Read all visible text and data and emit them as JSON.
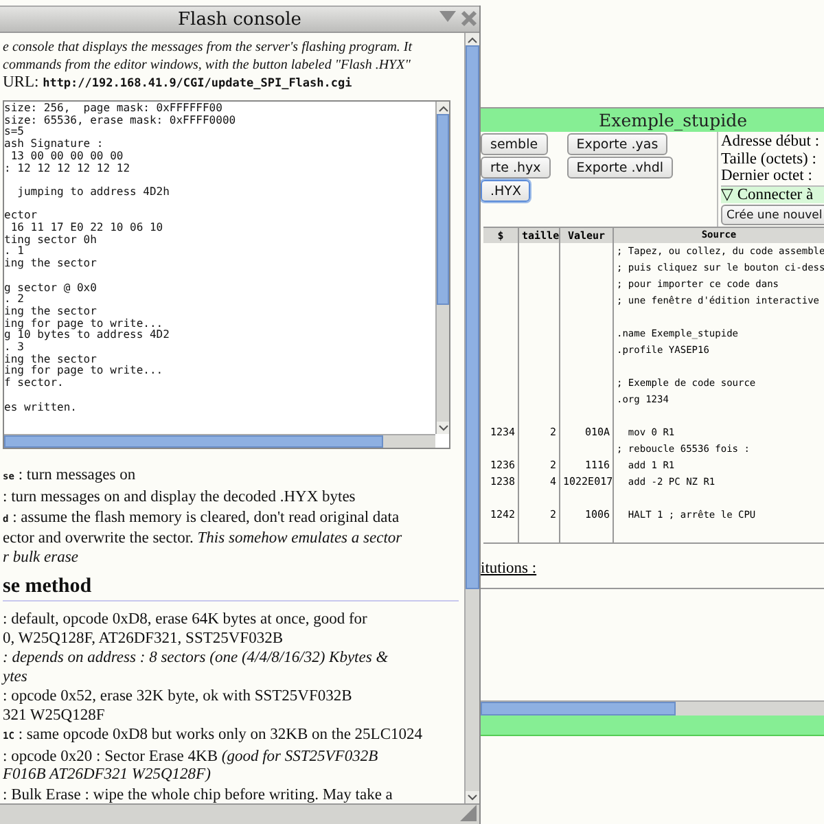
{
  "flash_console": {
    "title": "Flash console",
    "intro_lines": [
      {
        "text": "e console that displays the messages from the server's flashing program. It"
      },
      {
        "text": "commands from the editor windows, with the button labeled \"Flash .HYX\""
      }
    ],
    "url_line": "URL: **http://192.168.41.9/CGI/update_SPI_Flash.cgi**",
    "console_lines": [
      {
        "text": "size: 256,  page mask: 0xFFFFFF00"
      },
      {
        "text": "size: 65536, erase mask: 0xFFFF0000"
      },
      {
        "text": "s=5"
      },
      {
        "text": "ash Signature :"
      },
      {
        "text": " 13 00 00 00 00 00"
      },
      {
        "text": ": 12 12 12 12 12 12"
      },
      {
        "text": "  jumping to address 4D2h",
        "space_before": true
      },
      {
        "text": "ector",
        "space_before": true
      },
      {
        "text": " 16 11 17 E0 22 10 06 10"
      },
      {
        "text": "ting sector 0h"
      },
      {
        "text": ". 1"
      },
      {
        "text": "ing the sector"
      },
      {
        "text": "g sector @ 0x0",
        "space_before": true
      },
      {
        "text": ". 2"
      },
      {
        "text": "ing the sector"
      },
      {
        "text": "ing for page to write..."
      },
      {
        "text": "g 10 bytes to address 4D2"
      },
      {
        "text": ". 3"
      },
      {
        "text": "ing the sector"
      },
      {
        "text": "ing for page to write..."
      },
      {
        "text": "f sector."
      },
      {
        "text": "es written.",
        "space_before": true
      }
    ],
    "options": [
      {
        "lines": [
          {
            "text": "**se** : turn messages on"
          }
        ]
      },
      {
        "lines": [
          {
            "text": ": turn messages on and display the decoded .HYX bytes"
          }
        ]
      },
      {
        "lines": [
          {
            "text": "**d** : assume the flash memory is cleared, don't read original data"
          },
          {
            "text": "ector and overwrite the sector. *This somehow emulates a sector*"
          },
          {
            "text": "r bulk erase",
            "italic": true
          }
        ]
      }
    ],
    "erase_heading": "se method",
    "erase_methods": [
      {
        "lines": [
          {
            "text": ": default, opcode 0xD8, erase 64K bytes at once, good for"
          },
          {
            "text": "0, W25Q128F, AT26DF321, SST25VF032B"
          }
        ]
      },
      {
        "lines": [
          {
            "text": ": depends on address : 8 sectors (one (4/4/8/16/32) Kbytes &",
            "italic": true
          },
          {
            "text": "ytes",
            "italic": true
          }
        ]
      },
      {
        "lines": [
          {
            "text": ": opcode 0x52, erase 32K byte, ok with SST25VF032B"
          },
          {
            "text": "321 W25Q128F"
          }
        ]
      },
      {
        "lines": [
          {
            "text": "**1C** : same opcode 0xD8 but works only on 32KB on the 25LC1024"
          }
        ]
      },
      {
        "lines": [
          {
            "text": ": opcode 0x20 : Sector Erase 4KB *(good for SST25VF032B*"
          },
          {
            "text": "F016B AT26DF321 W25Q128F)",
            "italic": true
          }
        ]
      },
      {
        "lines": [
          {
            "text": ": Bulk Erase : wipe the whole chip before writing. May take a"
          }
        ]
      }
    ]
  },
  "editor": {
    "title": "Exemple_stupide",
    "buttons": [
      {
        "label": "semble",
        "focused": false
      },
      {
        "label": "Exporte .yas",
        "focused": false
      },
      {
        "label": "rte .hyx",
        "focused": false
      },
      {
        "label": "Exporte .vhdl",
        "focused": false
      },
      {
        "label": ".HYX",
        "focused": true
      }
    ],
    "info_labels": [
      "Adresse début :",
      "Taille (octets) :",
      "Dernier octet :"
    ],
    "connect_toggle": "▽ Connecter à",
    "new_button": "Crée une nouvel",
    "table": {
      "columns": [
        "$",
        "taille",
        "Valeur",
        "Source"
      ],
      "rows": [
        {
          "source": "; Tapez, ou collez, du code assemble"
        },
        {
          "source": "; puis cliquez sur le bouton ci-dess"
        },
        {
          "source": "; pour importer ce code dans"
        },
        {
          "source": "; une fenêtre d'édition interactive"
        },
        {
          "source": ".name Exemple_stupide",
          "space_before": true
        },
        {
          "source": ".profile YASEP16"
        },
        {
          "source": "; Exemple de code source",
          "space_before": true
        },
        {
          "source": ".org 1234"
        },
        {
          "addr": "1234",
          "size": "2",
          "value": "010A",
          "source": "  mov 0 R1",
          "space_before": true
        },
        {
          "source": "; reboucle 65536 fois :"
        },
        {
          "addr": "1236",
          "size": "2",
          "value": "1116",
          "source": "  add 1 R1"
        },
        {
          "addr": "1238",
          "size": "4",
          "value": "1022E017",
          "source": "  add -2 PC NZ R1"
        },
        {
          "addr": "1242",
          "size": "2",
          "value": "1006",
          "source": "  HALT 1 ; arrête le CPU",
          "space_before": true
        }
      ]
    },
    "substitutions_label": "itutions :"
  }
}
